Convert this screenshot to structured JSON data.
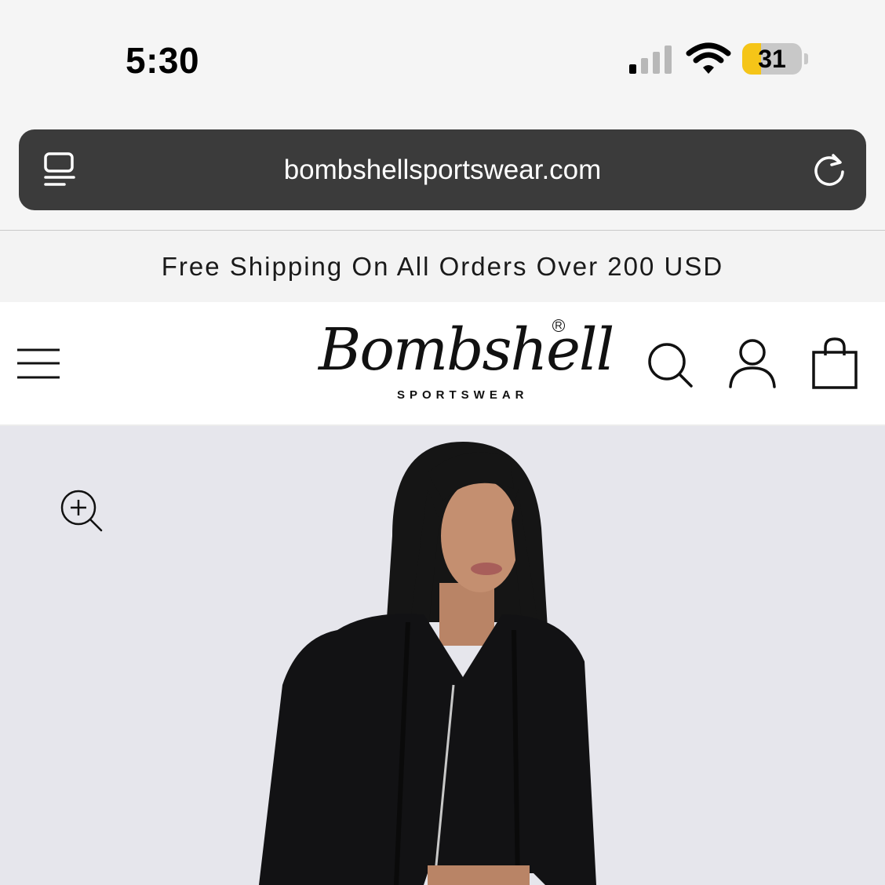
{
  "status_bar": {
    "time": "5:30",
    "battery_level": "31",
    "battery_fraction": 0.31,
    "signal_bars_active": 1,
    "signal_bars_total": 4,
    "icons": [
      "signal-icon",
      "wifi-icon",
      "battery-icon"
    ]
  },
  "browser": {
    "url": "bombshellsportswear.com",
    "icons": [
      "tabs-icon",
      "reload-icon"
    ]
  },
  "announcement": {
    "text": "Free Shipping On All Orders Over 200 USD"
  },
  "header": {
    "logo_script": "Bombshell",
    "logo_sub": "SPORTSWEAR",
    "logo_registered": "R",
    "icons": [
      "menu-icon",
      "search-icon",
      "account-icon",
      "cart-icon"
    ]
  },
  "product": {
    "image_icon": "zoom-in-icon",
    "colors": {
      "background": "#e6e6ec",
      "jacket": "#121214"
    }
  },
  "colors": {
    "url_bar": "#3b3b3b",
    "battery_fill": "#f5c518",
    "text": "#1a1a1a"
  }
}
